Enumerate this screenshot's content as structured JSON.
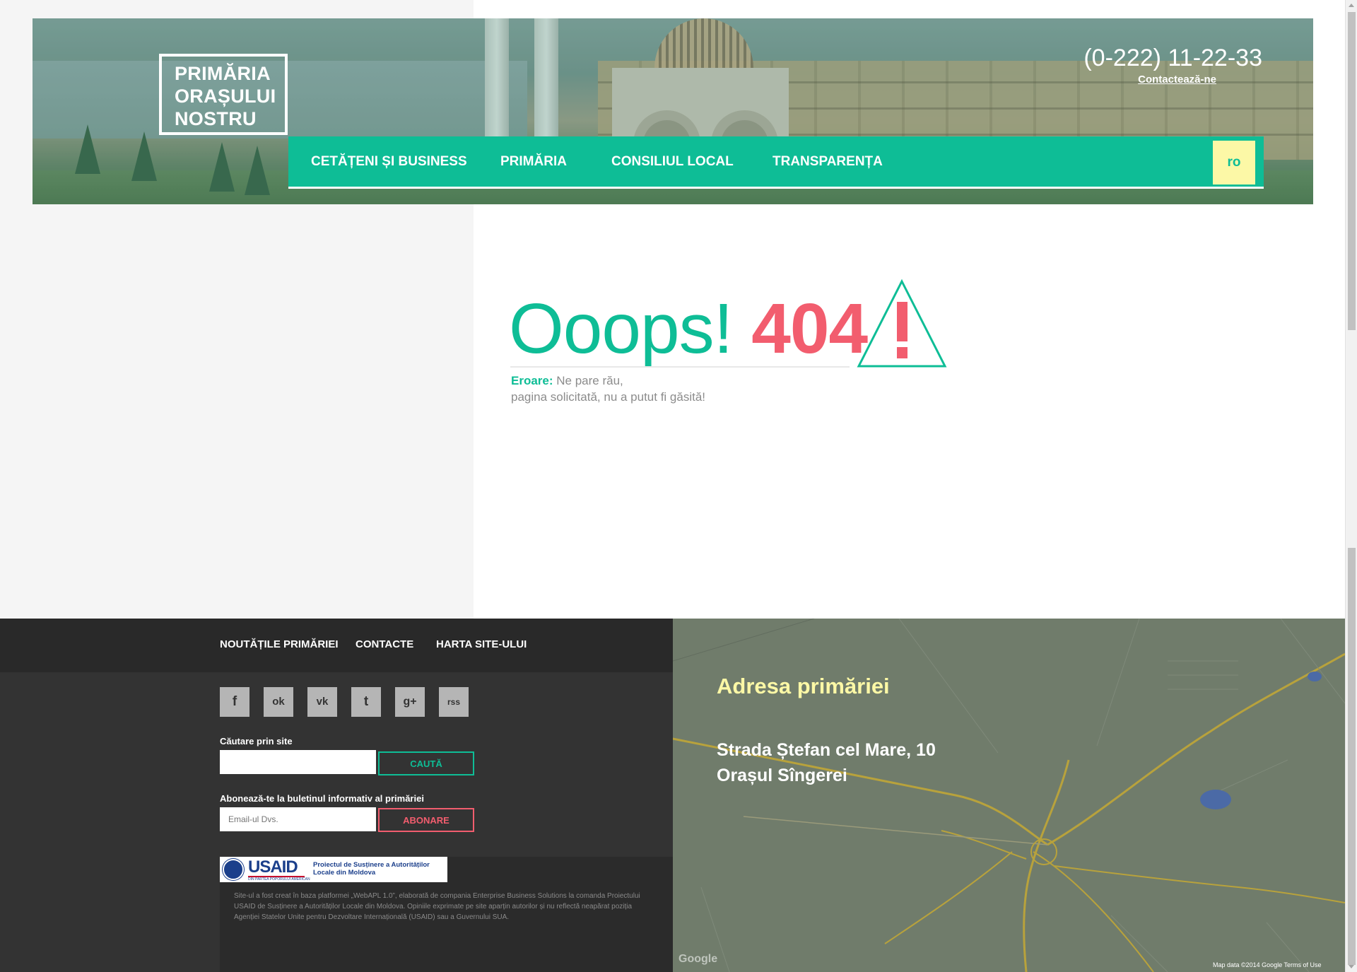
{
  "header": {
    "logo_lines": [
      "PRIMĂRIA",
      "ORAȘULUI",
      "NOSTRU"
    ],
    "phone": "(0-222) 11-22-33",
    "contact_link": "Contactează-ne",
    "nav": [
      "CETĂȚENI ȘI BUSINESS",
      "PRIMĂRIA",
      "CONSILIUL LOCAL",
      "TRANSPARENȚA"
    ],
    "lang": "ro"
  },
  "error": {
    "oops": "Ooops!",
    "code": "404",
    "label": "Eroare:",
    "line1": "Ne pare rău,",
    "line2": "pagina solicitată, nu a putut fi găsită!"
  },
  "footer": {
    "nav": [
      "NOUTĂȚILE PRIMĂRIEI",
      "CONTACTE",
      "HARTA SITE-ULUI"
    ],
    "social_icons": [
      "facebook-icon",
      "odnoklassniki-icon",
      "vk-icon",
      "twitter-icon",
      "google-plus-icon",
      "rss-icon"
    ],
    "social_glyphs": [
      "f",
      "ok",
      "vk",
      "t",
      "g+",
      "rss"
    ],
    "search_label": "Căutare prin site",
    "search_value": "",
    "search_button": "CAUTĂ",
    "subscribe_label": "Abonează-te la buletinul informativ al primăriei",
    "email_placeholder": "Email-ul Dvs.",
    "subscribe_button": "ABONARE",
    "usaid_word": "USAID",
    "usaid_sub": "DIN PARTEA POPORULUI AMERICAN",
    "usaid_project": "Proiectul de Susținere a Autorităților Locale din Moldova",
    "disclaimer": "Site-ul a fost creat în baza platformei „WebAPL 1.0”, elaborată de compania Enterprise Business Solutions la comanda Proiectului USAID de Susținere a Autorităților Locale din Moldova. Opiniile exprimate pe site aparțin autorilor și nu reflectă neapărat poziția Agenției Statelor Unite pentru Dezvoltare Internațională (USAID) sau a Guvernului SUA."
  },
  "map": {
    "title": "Adresa primăriei",
    "address_line1": "Strada Ștefan cel Mare, 10",
    "address_line2": "Orașul Sîngerei",
    "credit": "Map data ©2014 Google    Terms of Use",
    "google": "Google"
  },
  "colors": {
    "accent": "#0ebd96",
    "error": "#f25d6e",
    "highlight": "#fcf8a6",
    "footer_dark": "#333333"
  }
}
